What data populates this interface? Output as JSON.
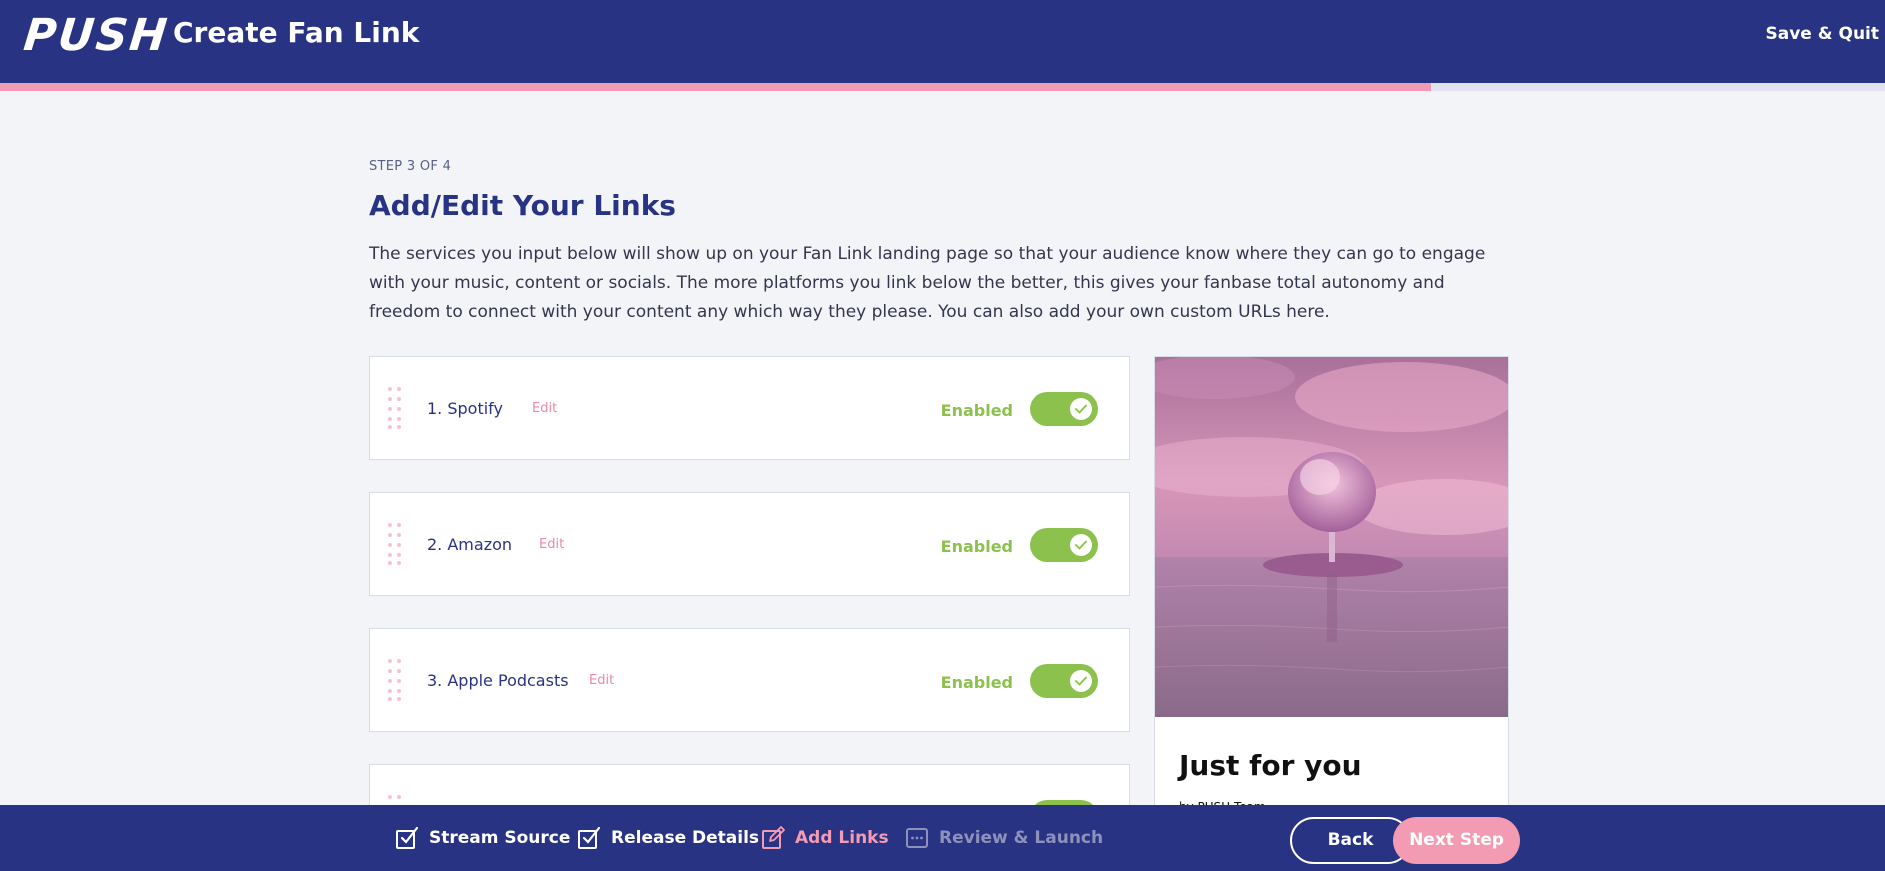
{
  "header": {
    "logo": "PUSH",
    "title": "Create Fan Link",
    "save_quit": "Save & Quit"
  },
  "progress": {
    "fraction": 0.759
  },
  "main": {
    "step_label": "STEP 3 OF 4",
    "title": "Add/Edit Your Links",
    "description": "The services you input below will show up on your Fan Link landing page so that your audience know where they can go to engage with your music, content or socials. The more platforms you link below the better, this gives your fanbase total autonomy and freedom to connect with your content any which way they please. You can also add your own custom URLs here.",
    "links": [
      {
        "name": "1. Spotify",
        "edit": "Edit",
        "status": "Enabled",
        "enabled": true
      },
      {
        "name": "2. Amazon",
        "edit": "Edit",
        "status": "Enabled",
        "enabled": true
      },
      {
        "name": "3. Apple Podcasts",
        "edit": "Edit",
        "status": "Enabled",
        "enabled": true
      },
      {
        "name": "",
        "edit": "",
        "status": "",
        "enabled": true
      }
    ]
  },
  "preview": {
    "title": "Just for you",
    "byline": "by PUSH Team"
  },
  "footer": {
    "steps": [
      {
        "label": "Stream Source",
        "state": "done",
        "icon": "checkbox-checked-icon"
      },
      {
        "label": "Release Details",
        "state": "done",
        "icon": "checkbox-checked-icon"
      },
      {
        "label": "Add Links",
        "state": "active",
        "icon": "pencil-edit-icon"
      },
      {
        "label": "Review & Launch",
        "state": "upcoming",
        "icon": "dotted-box-icon"
      }
    ],
    "back": "Back",
    "next": "Next Step"
  },
  "colors": {
    "brand_navy": "#293383",
    "accent_pink": "#f29bb2",
    "enabled_green": "#8cc14e"
  }
}
